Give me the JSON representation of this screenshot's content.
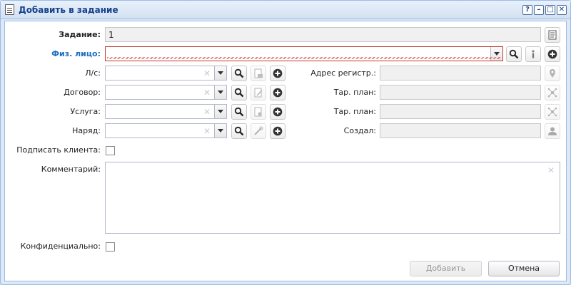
{
  "window": {
    "title": "Добавить в задание",
    "tools": [
      "?",
      "–",
      "□",
      "✕"
    ]
  },
  "form": {
    "task_label": "Задание:",
    "task_value": "1",
    "person_label": "Физ. лицо:",
    "person_value": "",
    "account_label": "Л/с:",
    "contract_label": "Договор:",
    "service_label": "Услуга:",
    "order_label": "Наряд:",
    "address_label": "Адрес регистр.:",
    "tariff1_label": "Тар. план:",
    "tariff2_label": "Тар. план:",
    "created_label": "Создал:",
    "sign_label": "Подписать клиента:",
    "comment_label": "Комментарий:",
    "confidential_label": "Конфиденциально:"
  },
  "footer": {
    "add_label": "Добавить",
    "cancel_label": "Отмена"
  },
  "colors": {
    "title_text": "#15428b",
    "required_label": "#1b6ec2",
    "invalid_border": "#c0392b",
    "window_bg": "#dfe9f5"
  }
}
